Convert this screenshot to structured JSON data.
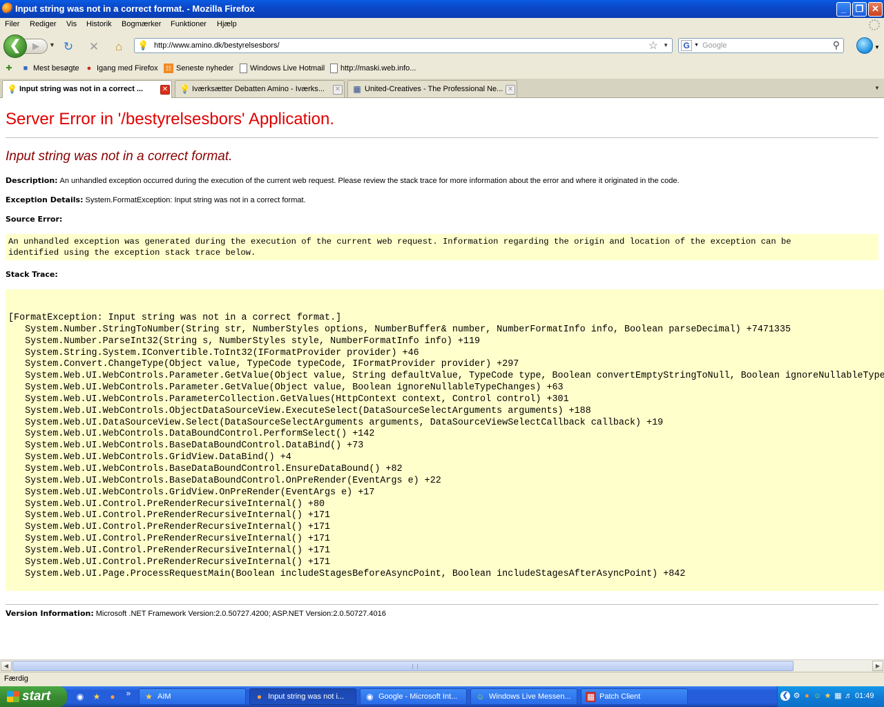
{
  "window": {
    "title": "Input string was not in a correct format. - Mozilla Firefox",
    "minimize": "_",
    "maximize": "❐",
    "close": "✕"
  },
  "menu": [
    "Filer",
    "Rediger",
    "Vis",
    "Historik",
    "Bogmærker",
    "Funktioner",
    "Hjælp"
  ],
  "nav": {
    "url": "http://www.amino.dk/bestyrelsesbors/",
    "search_placeholder": "Google"
  },
  "bookmarks": [
    {
      "label": "Mest besøgte",
      "icon": "bookmark-folder-icon"
    },
    {
      "label": "Igang med Firefox",
      "icon": "firefox-icon"
    },
    {
      "label": "Seneste nyheder",
      "icon": "rss-icon"
    },
    {
      "label": "Windows Live Hotmail",
      "icon": "page-icon"
    },
    {
      "label": "http://maski.web.info...",
      "icon": "page-icon"
    }
  ],
  "tabs": [
    {
      "label": "Input string was not in a correct ...",
      "icon": "lightbulb-icon",
      "active": true
    },
    {
      "label": "Iværksætter Debatten Amino - Iværks...",
      "icon": "lightbulb-icon",
      "active": false
    },
    {
      "label": "United-Creatives - The Professional Ne...",
      "icon": "bookmark-icon",
      "active": false
    }
  ],
  "page": {
    "heading": "Server Error in '/bestyrelsesbors' Application.",
    "subheading": "Input string was not in a correct format.",
    "description_label": "Description:",
    "description_text": "An unhandled exception occurred during the execution of the current web request. Please review the stack trace for more information about the error and where it originated in the code.",
    "exception_label": "Exception Details:",
    "exception_text": "System.FormatException: Input string was not in a correct format.",
    "source_error_label": "Source Error:",
    "source_error_text": "An unhandled exception was generated during the execution of the current web request. Information regarding the origin and location of the exception can be\nidentified using the exception stack trace below.",
    "stack_trace_label": "Stack Trace:",
    "stack_trace": [
      "[FormatException: Input string was not in a correct format.]",
      "   System.Number.StringToNumber(String str, NumberStyles options, NumberBuffer& number, NumberFormatInfo info, Boolean parseDecimal) +7471335",
      "   System.Number.ParseInt32(String s, NumberStyles style, NumberFormatInfo info) +119",
      "   System.String.System.IConvertible.ToInt32(IFormatProvider provider) +46",
      "   System.Convert.ChangeType(Object value, TypeCode typeCode, IFormatProvider provider) +297",
      "   System.Web.UI.WebControls.Parameter.GetValue(Object value, String defaultValue, TypeCode type, Boolean convertEmptyStringToNull, Boolean ignoreNullableTypeC",
      "   System.Web.UI.WebControls.Parameter.GetValue(Object value, Boolean ignoreNullableTypeChanges) +63",
      "   System.Web.UI.WebControls.ParameterCollection.GetValues(HttpContext context, Control control) +301",
      "   System.Web.UI.WebControls.ObjectDataSourceView.ExecuteSelect(DataSourceSelectArguments arguments) +188",
      "   System.Web.UI.DataSourceView.Select(DataSourceSelectArguments arguments, DataSourceViewSelectCallback callback) +19",
      "   System.Web.UI.WebControls.DataBoundControl.PerformSelect() +142",
      "   System.Web.UI.WebControls.BaseDataBoundControl.DataBind() +73",
      "   System.Web.UI.WebControls.GridView.DataBind() +4",
      "   System.Web.UI.WebControls.BaseDataBoundControl.EnsureDataBound() +82",
      "   System.Web.UI.WebControls.BaseDataBoundControl.OnPreRender(EventArgs e) +22",
      "   System.Web.UI.WebControls.GridView.OnPreRender(EventArgs e) +17",
      "   System.Web.UI.Control.PreRenderRecursiveInternal() +80",
      "   System.Web.UI.Control.PreRenderRecursiveInternal() +171",
      "   System.Web.UI.Control.PreRenderRecursiveInternal() +171",
      "   System.Web.UI.Control.PreRenderRecursiveInternal() +171",
      "   System.Web.UI.Control.PreRenderRecursiveInternal() +171",
      "   System.Web.UI.Control.PreRenderRecursiveInternal() +171",
      "   System.Web.UI.Page.ProcessRequestMain(Boolean includeStagesBeforeAsyncPoint, Boolean includeStagesAfterAsyncPoint) +842"
    ],
    "version_label": "Version Information:",
    "version_text": "Microsoft .NET Framework Version:2.0.50727.4200; ASP.NET Version:2.0.50727.4016"
  },
  "status": "Færdig",
  "taskbar": {
    "start_label": "start",
    "quicklaunch": [
      "ie-icon",
      "aim-icon",
      "firefox-icon"
    ],
    "quicklaunch_more": "»",
    "tasks": [
      {
        "label": "AIM",
        "icon": "aim-icon",
        "active": false
      },
      {
        "label": "Input string was not i...",
        "icon": "firefox-icon",
        "active": true
      },
      {
        "label": "Google - Microsoft Int...",
        "icon": "ie-icon",
        "active": false
      },
      {
        "label": "Windows Live Messen...",
        "icon": "messenger-icon",
        "active": false
      },
      {
        "label": "Patch Client",
        "icon": "patch-client-icon",
        "active": false
      }
    ],
    "clock": "01:49"
  }
}
